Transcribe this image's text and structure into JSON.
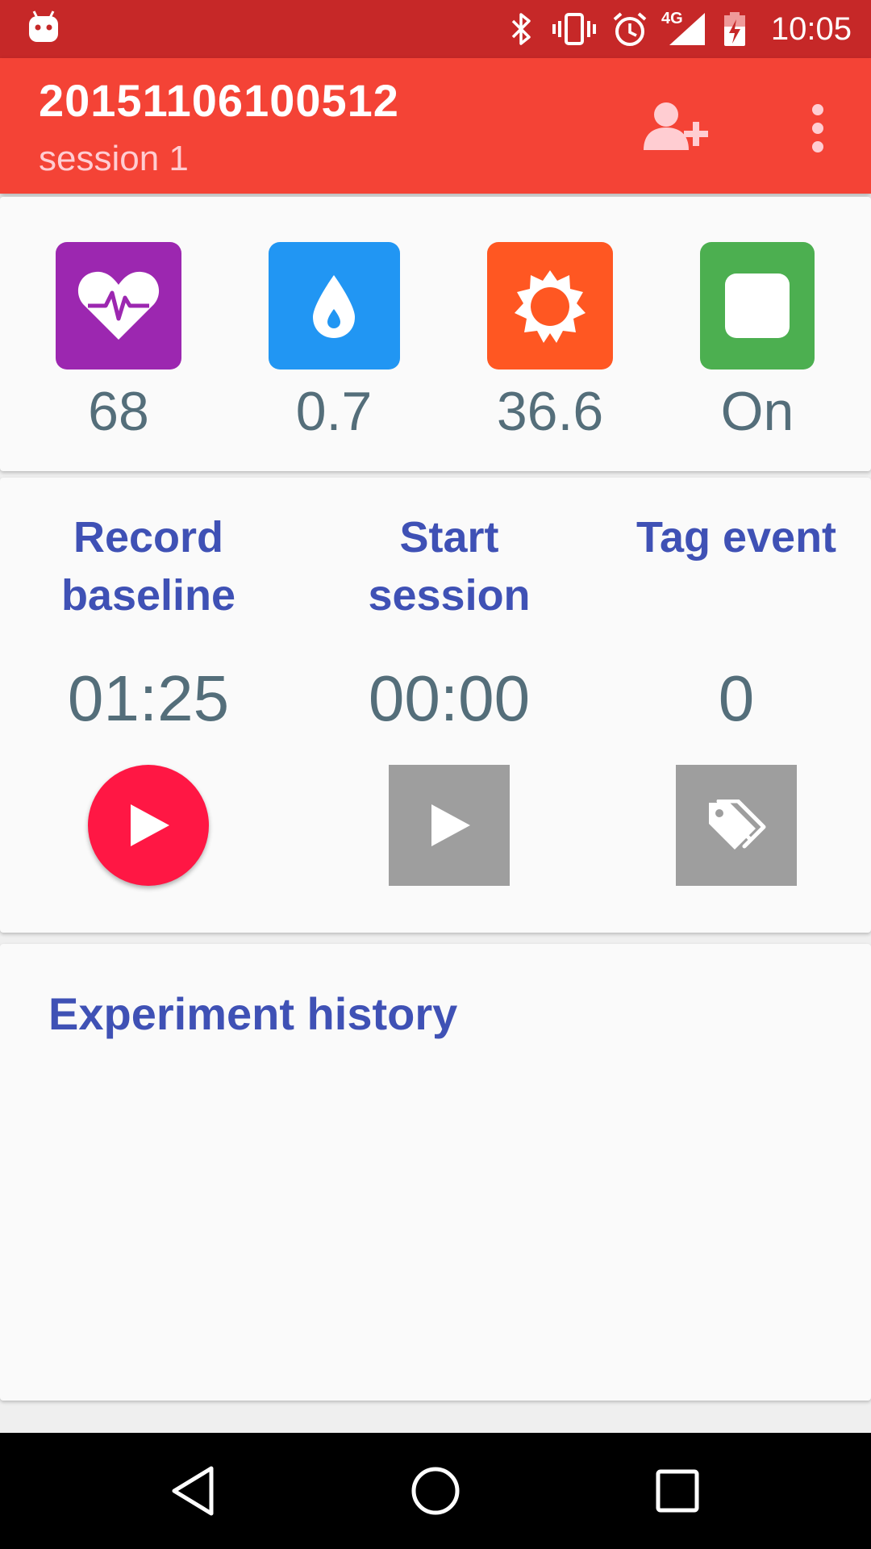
{
  "status_bar": {
    "time": "10:05",
    "network_label": "4G",
    "icons": [
      "android-icon",
      "bluetooth-icon",
      "vibrate-icon",
      "alarm-icon",
      "signal-icon",
      "battery-icon"
    ]
  },
  "app_bar": {
    "title": "20151106100512",
    "subtitle": "session 1",
    "actions": [
      "add-user-icon",
      "more-vert-icon"
    ]
  },
  "sensors": [
    {
      "icon": "heart-rate-icon",
      "value": "68",
      "color": "#9c27b0"
    },
    {
      "icon": "water-drop-icon",
      "value": "0.7",
      "color": "#2196f3"
    },
    {
      "icon": "sun-icon",
      "value": "36.6",
      "color": "#ff5722"
    },
    {
      "icon": "stop-square-icon",
      "value": "On",
      "color": "#4caf50"
    }
  ],
  "actions": [
    {
      "label": "Record baseline",
      "value": "01:25",
      "icon": "play-icon",
      "style": "round",
      "color": "#ff1744"
    },
    {
      "label": "Start session",
      "value": "00:00",
      "icon": "play-icon",
      "style": "square",
      "color": "#9e9e9e"
    },
    {
      "label": "Tag event",
      "value": "0",
      "icon": "tags-icon",
      "style": "square",
      "color": "#9e9e9e"
    }
  ],
  "history": {
    "title": "Experiment history"
  },
  "nav_bar": {
    "icons": [
      "back-icon",
      "home-icon",
      "recents-icon"
    ]
  }
}
